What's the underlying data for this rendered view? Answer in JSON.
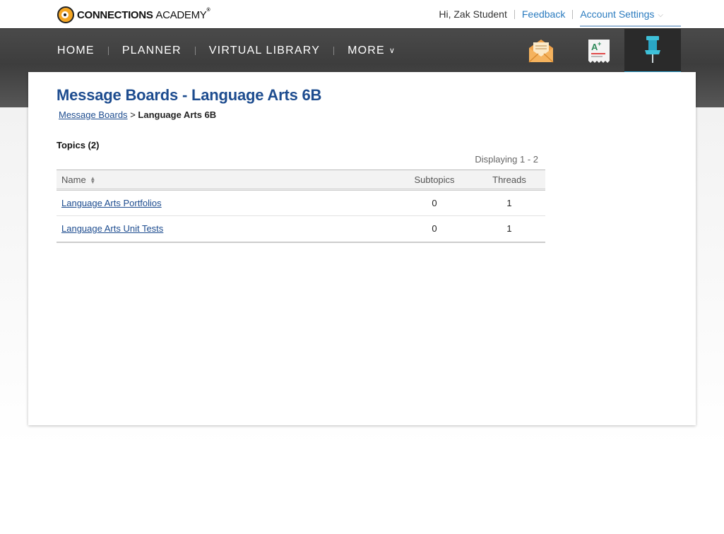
{
  "brand": {
    "name_bold": "CONNECTIONS",
    "name_light": "ACADEMY",
    "trademark": "®"
  },
  "utility": {
    "greeting": "Hi, Zak Student",
    "feedback": "Feedback",
    "account_settings": "Account Settings"
  },
  "nav": {
    "items": [
      {
        "label": "HOME"
      },
      {
        "label": "PLANNER"
      },
      {
        "label": "VIRTUAL LIBRARY"
      },
      {
        "label": "MORE"
      }
    ],
    "icons": [
      "mail-icon",
      "grade-report-icon",
      "pushpin-icon"
    ],
    "active_accent": "#2aa6d6"
  },
  "page": {
    "title": "Message Boards - Language Arts 6B",
    "breadcrumb": {
      "parent": "Message Boards",
      "separator": ">",
      "current": "Language Arts 6B"
    },
    "topics_label": "Topics (2)",
    "displaying": "Displaying 1 - 2"
  },
  "table": {
    "columns": {
      "name": "Name",
      "subtopics": "Subtopics",
      "threads": "Threads"
    },
    "rows": [
      {
        "name": "Language Arts Portfolios",
        "subtopics": "0",
        "threads": "1"
      },
      {
        "name": "Language Arts Unit Tests",
        "subtopics": "0",
        "threads": "1"
      }
    ]
  },
  "colors": {
    "title_blue": "#1d4c8f",
    "link_blue": "#2a7bbf",
    "nav_dark": "#444444"
  }
}
